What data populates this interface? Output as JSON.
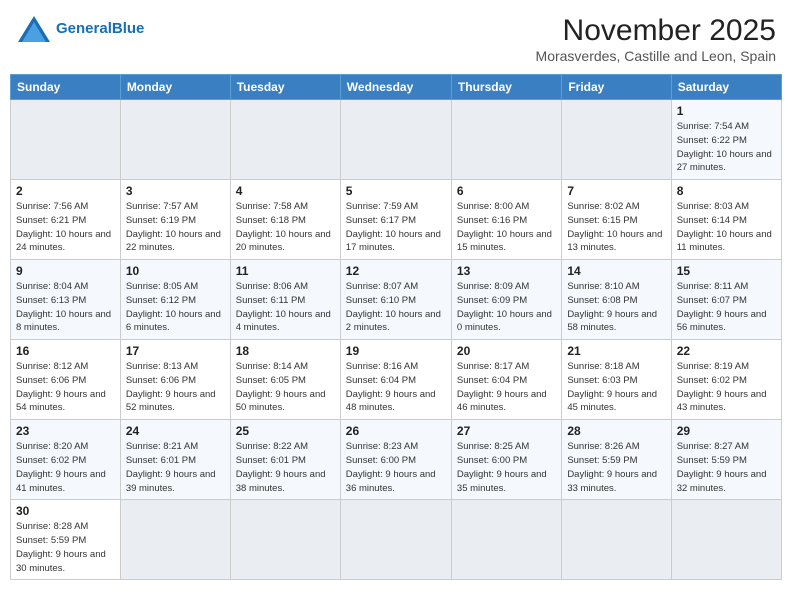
{
  "header": {
    "logo_general": "General",
    "logo_blue": "Blue",
    "month": "November 2025",
    "location": "Morasverdes, Castille and Leon, Spain"
  },
  "days_of_week": [
    "Sunday",
    "Monday",
    "Tuesday",
    "Wednesday",
    "Thursday",
    "Friday",
    "Saturday"
  ],
  "weeks": [
    [
      {
        "day": "",
        "info": ""
      },
      {
        "day": "",
        "info": ""
      },
      {
        "day": "",
        "info": ""
      },
      {
        "day": "",
        "info": ""
      },
      {
        "day": "",
        "info": ""
      },
      {
        "day": "",
        "info": ""
      },
      {
        "day": "1",
        "info": "Sunrise: 7:54 AM\nSunset: 6:22 PM\nDaylight: 10 hours and 27 minutes."
      }
    ],
    [
      {
        "day": "2",
        "info": "Sunrise: 7:56 AM\nSunset: 6:21 PM\nDaylight: 10 hours and 24 minutes."
      },
      {
        "day": "3",
        "info": "Sunrise: 7:57 AM\nSunset: 6:19 PM\nDaylight: 10 hours and 22 minutes."
      },
      {
        "day": "4",
        "info": "Sunrise: 7:58 AM\nSunset: 6:18 PM\nDaylight: 10 hours and 20 minutes."
      },
      {
        "day": "5",
        "info": "Sunrise: 7:59 AM\nSunset: 6:17 PM\nDaylight: 10 hours and 17 minutes."
      },
      {
        "day": "6",
        "info": "Sunrise: 8:00 AM\nSunset: 6:16 PM\nDaylight: 10 hours and 15 minutes."
      },
      {
        "day": "7",
        "info": "Sunrise: 8:02 AM\nSunset: 6:15 PM\nDaylight: 10 hours and 13 minutes."
      },
      {
        "day": "8",
        "info": "Sunrise: 8:03 AM\nSunset: 6:14 PM\nDaylight: 10 hours and 11 minutes."
      }
    ],
    [
      {
        "day": "9",
        "info": "Sunrise: 8:04 AM\nSunset: 6:13 PM\nDaylight: 10 hours and 8 minutes."
      },
      {
        "day": "10",
        "info": "Sunrise: 8:05 AM\nSunset: 6:12 PM\nDaylight: 10 hours and 6 minutes."
      },
      {
        "day": "11",
        "info": "Sunrise: 8:06 AM\nSunset: 6:11 PM\nDaylight: 10 hours and 4 minutes."
      },
      {
        "day": "12",
        "info": "Sunrise: 8:07 AM\nSunset: 6:10 PM\nDaylight: 10 hours and 2 minutes."
      },
      {
        "day": "13",
        "info": "Sunrise: 8:09 AM\nSunset: 6:09 PM\nDaylight: 10 hours and 0 minutes."
      },
      {
        "day": "14",
        "info": "Sunrise: 8:10 AM\nSunset: 6:08 PM\nDaylight: 9 hours and 58 minutes."
      },
      {
        "day": "15",
        "info": "Sunrise: 8:11 AM\nSunset: 6:07 PM\nDaylight: 9 hours and 56 minutes."
      }
    ],
    [
      {
        "day": "16",
        "info": "Sunrise: 8:12 AM\nSunset: 6:06 PM\nDaylight: 9 hours and 54 minutes."
      },
      {
        "day": "17",
        "info": "Sunrise: 8:13 AM\nSunset: 6:06 PM\nDaylight: 9 hours and 52 minutes."
      },
      {
        "day": "18",
        "info": "Sunrise: 8:14 AM\nSunset: 6:05 PM\nDaylight: 9 hours and 50 minutes."
      },
      {
        "day": "19",
        "info": "Sunrise: 8:16 AM\nSunset: 6:04 PM\nDaylight: 9 hours and 48 minutes."
      },
      {
        "day": "20",
        "info": "Sunrise: 8:17 AM\nSunset: 6:04 PM\nDaylight: 9 hours and 46 minutes."
      },
      {
        "day": "21",
        "info": "Sunrise: 8:18 AM\nSunset: 6:03 PM\nDaylight: 9 hours and 45 minutes."
      },
      {
        "day": "22",
        "info": "Sunrise: 8:19 AM\nSunset: 6:02 PM\nDaylight: 9 hours and 43 minutes."
      }
    ],
    [
      {
        "day": "23",
        "info": "Sunrise: 8:20 AM\nSunset: 6:02 PM\nDaylight: 9 hours and 41 minutes."
      },
      {
        "day": "24",
        "info": "Sunrise: 8:21 AM\nSunset: 6:01 PM\nDaylight: 9 hours and 39 minutes."
      },
      {
        "day": "25",
        "info": "Sunrise: 8:22 AM\nSunset: 6:01 PM\nDaylight: 9 hours and 38 minutes."
      },
      {
        "day": "26",
        "info": "Sunrise: 8:23 AM\nSunset: 6:00 PM\nDaylight: 9 hours and 36 minutes."
      },
      {
        "day": "27",
        "info": "Sunrise: 8:25 AM\nSunset: 6:00 PM\nDaylight: 9 hours and 35 minutes."
      },
      {
        "day": "28",
        "info": "Sunrise: 8:26 AM\nSunset: 5:59 PM\nDaylight: 9 hours and 33 minutes."
      },
      {
        "day": "29",
        "info": "Sunrise: 8:27 AM\nSunset: 5:59 PM\nDaylight: 9 hours and 32 minutes."
      }
    ],
    [
      {
        "day": "30",
        "info": "Sunrise: 8:28 AM\nSunset: 5:59 PM\nDaylight: 9 hours and 30 minutes."
      },
      {
        "day": "",
        "info": ""
      },
      {
        "day": "",
        "info": ""
      },
      {
        "day": "",
        "info": ""
      },
      {
        "day": "",
        "info": ""
      },
      {
        "day": "",
        "info": ""
      },
      {
        "day": "",
        "info": ""
      }
    ]
  ]
}
